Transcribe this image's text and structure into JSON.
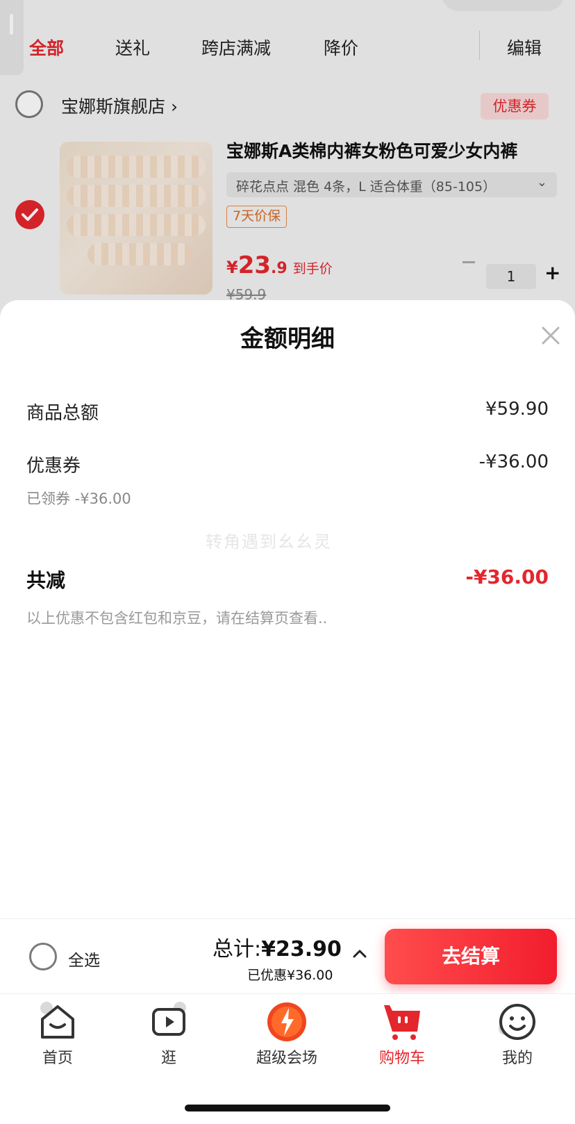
{
  "tabs": [
    "全部",
    "送礼",
    "跨店满减",
    "降价"
  ],
  "edit_label": "编辑",
  "shop": {
    "name": "宝娜斯旗舰店 ›",
    "coupon_chip": "优惠券"
  },
  "product": {
    "title": "宝娜斯A类棉内裤女粉色可爱少女内裤",
    "spec": "碎花点点 混色 4条，L 适合体重（85-105）",
    "spec_caret": "⌄",
    "guarantee": "7天价保",
    "price_yen": "¥",
    "price_int": "23",
    "price_dec": ".9",
    "price_tag": "到手价",
    "price_old": "¥59.9",
    "quantity": "1",
    "qty_plus": "+"
  },
  "sheet": {
    "title": "金额明细",
    "rows": [
      {
        "label": "商品总额",
        "value": "¥59.90"
      },
      {
        "label": "优惠券",
        "value": "-¥36.00",
        "sub": "已领券 -¥36.00"
      }
    ],
    "total_label": "共减",
    "total_value": "-¥36.00",
    "note": "以上优惠不包含红包和京豆，请在结算页查看..",
    "watermark": "转角遇到幺幺灵"
  },
  "checkout": {
    "select_all": "全选",
    "total_prefix": "总计:",
    "total_amount": "¥23.90",
    "saved": "已优惠¥36.00",
    "button": "去结算"
  },
  "tabbar": [
    {
      "label": "首页",
      "icon": "home-icon"
    },
    {
      "label": "逛",
      "icon": "video-icon"
    },
    {
      "label": "超级会场",
      "icon": "super-venue-icon"
    },
    {
      "label": "购物车",
      "icon": "cart-icon",
      "active": true
    },
    {
      "label": "我的",
      "icon": "profile-icon"
    }
  ],
  "colors": {
    "accent": "#e4262d",
    "checkout_button": "#f21d2d"
  }
}
